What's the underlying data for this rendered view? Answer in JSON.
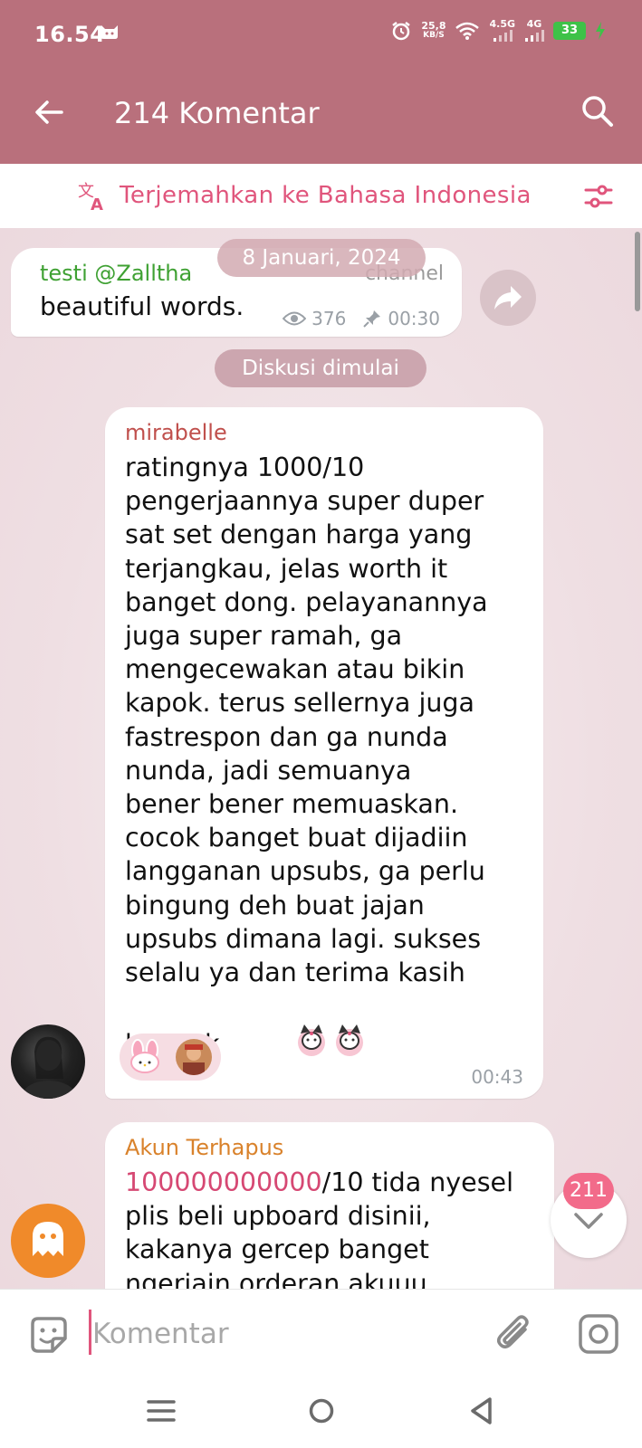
{
  "status_bar": {
    "time": "16.54",
    "net_speed_value": "25,8",
    "net_speed_unit": "KB/S",
    "signal1_label": "4.5G",
    "signal2_label": "4G",
    "battery": "33"
  },
  "app_bar": {
    "title": "214 Komentar"
  },
  "translate_bar": {
    "label": "Terjemahkan ke Bahasa Indonesia"
  },
  "chat": {
    "date_label": "8 Januari, 2024",
    "channel_post": {
      "sender": "testi @Zalltha",
      "tag": "channel",
      "text": "beautiful words.",
      "views": "376",
      "time": "00:30"
    },
    "service_label": "Diskusi dimulai",
    "messages": [
      {
        "sender": "mirabelle",
        "sender_color": "#c0504d",
        "text": "ratingnya 1000/10\npengerjaannya super duper\nsat set dengan harga yang\nterjangkau, jelas worth it\nbanget dong. pelayanannya\njuga super ramah, ga\nmengecewakan atau bikin\nkapok. terus sellernya juga\nfastrespon dan ga nunda\nnunda, jadi semuanya\nbener bener memuaskan.\ncocok banget buat dijadiin\nlangganan upsubs, ga perlu\nbingung deh buat jajan\nupsubs dimana lagi. sukses\nselalu ya dan terima kasih\nbanyak",
        "time": "00:43"
      },
      {
        "sender": "Akun Terhapus",
        "sender_color": "#d9822b",
        "highlight": "100000000000",
        "text_after_highlight": "/10 tida nyesel",
        "text_rest": "plis beli upboard disinii,\nkakanya gercep banget\nngerjain orderan akuuu"
      }
    ],
    "unread_count": "211"
  },
  "input_bar": {
    "placeholder": "Komentar"
  },
  "colors": {
    "header_bg": "#b9707c",
    "accent": "#e0557c",
    "channel_sender": "#3fa133"
  }
}
